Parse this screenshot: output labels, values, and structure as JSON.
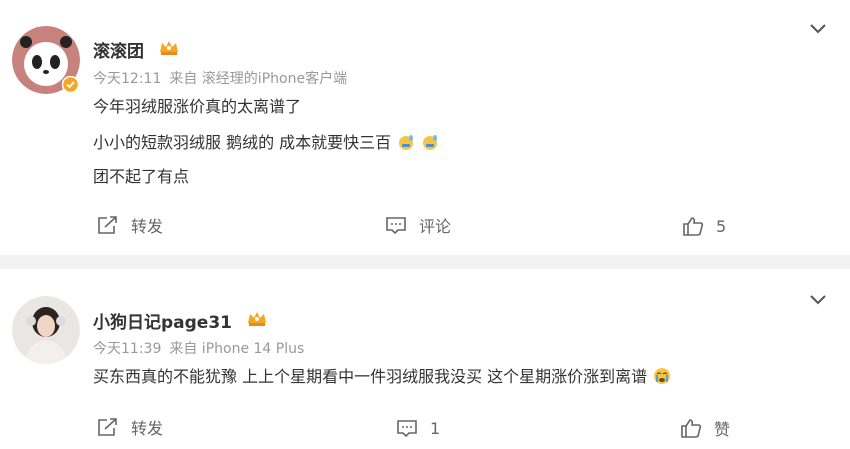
{
  "posts": [
    {
      "username": "滚滚团",
      "time": "今天12:11",
      "source": "来自 滚经理的iPhone客户端",
      "lines": [
        "今年羽绒服涨价真的太离谱了",
        "小小的短款羽绒服 鹅绒的 成本就要快三百",
        "团不起了有点"
      ],
      "actions": {
        "repost": "转发",
        "comment": "评论",
        "like": "5"
      }
    },
    {
      "username": "小狗日记page31",
      "time": "今天11:39",
      "source": "来自 iPhone 14 Plus",
      "lines": [
        "买东西真的不能犹豫 上上个星期看中一件羽绒服我没买 这个星期涨价涨到离谱"
      ],
      "actions": {
        "repost": "转发",
        "comment": "1",
        "like": "赞"
      }
    }
  ],
  "colors": {
    "text": "#333333",
    "meta": "#999999",
    "divider": "#f2f2f2",
    "vip_orange": "#f5a623",
    "verified": "#f5a623"
  },
  "icons": [
    "chevron-down-icon",
    "repost-icon",
    "comment-icon",
    "like-icon",
    "vip-crown-icon",
    "verified-badge-icon",
    "sweat-emoji-icon",
    "cry-emoji-icon"
  ]
}
